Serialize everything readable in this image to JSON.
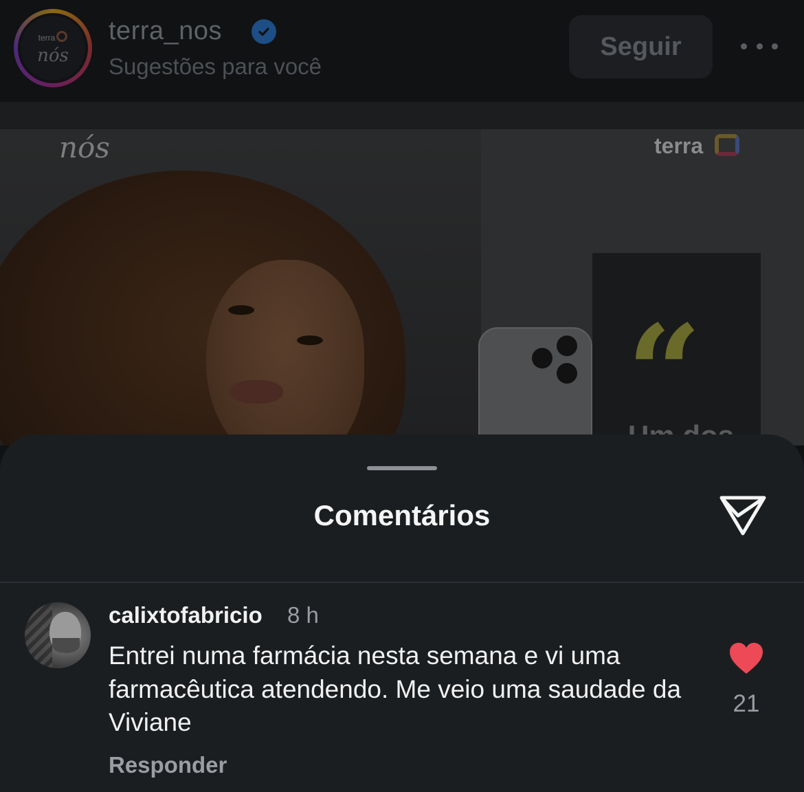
{
  "header": {
    "username": "terra_nos",
    "subtitle": "Sugestões para você",
    "follow_label": "Seguir",
    "avatar_brand": "terra",
    "avatar_script": "nós"
  },
  "post": {
    "brand_left": "nós",
    "brand_right": "terra",
    "quote_mark": "“",
    "cut_text": "Um dos"
  },
  "comments_sheet": {
    "title": "Comentários",
    "comments": [
      {
        "username": "calixtofabricio",
        "time": "8 h",
        "text": "Entrei numa farmácia nesta semana e vi uma farmacêutica atendendo. Me veio uma saudade da Viviane",
        "reply_label": "Responder",
        "likes": "21"
      }
    ]
  },
  "colors": {
    "heart": "#ed4956",
    "verified_badge": "#1d4e86",
    "sheet_bg": "#1b1e21"
  },
  "icons": [
    "verified-badge-icon",
    "more-options-icon",
    "share-icon",
    "heart-icon"
  ]
}
